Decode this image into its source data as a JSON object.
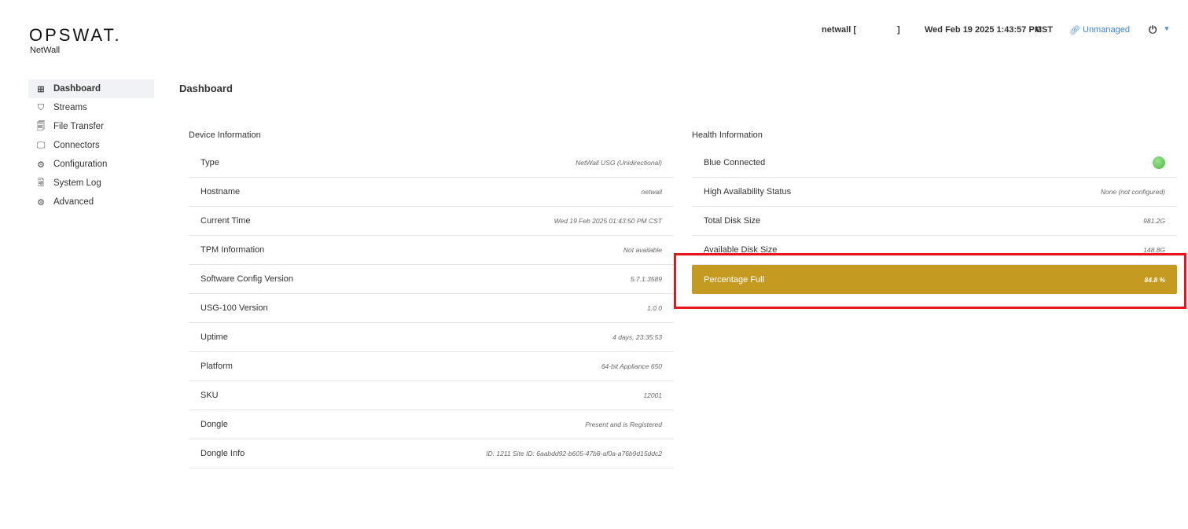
{
  "brand": {
    "logo": "OPSWAT.",
    "product": "NetWall"
  },
  "header": {
    "host": "netwall [",
    "host_end": "]",
    "datetime": "Wed Feb 19 2025 1:43:57 PM",
    "tz": "CST",
    "managed": "Unmanaged"
  },
  "sidebar": {
    "items": [
      {
        "label": "Dashboard",
        "icon": "grid-icon"
      },
      {
        "label": "Streams",
        "icon": "shield-icon"
      },
      {
        "label": "File Transfer",
        "icon": "file-icon"
      },
      {
        "label": "Connectors",
        "icon": "monitor-icon"
      },
      {
        "label": "Configuration",
        "icon": "gear-icon"
      },
      {
        "label": "System Log",
        "icon": "log-icon"
      },
      {
        "label": "Advanced",
        "icon": "gear-icon"
      }
    ]
  },
  "page_title": "Dashboard",
  "device": {
    "title": "Device Information",
    "rows": [
      {
        "k": "Type",
        "v": "NetWall USG (Unidirectional)"
      },
      {
        "k": "Hostname",
        "v": "netwall"
      },
      {
        "k": "Current Time",
        "v": "Wed 19 Feb 2025 01:43:50 PM CST"
      },
      {
        "k": "TPM Information",
        "v": "Not available"
      },
      {
        "k": "Software Config Version",
        "v": "5.7.1.3589"
      },
      {
        "k": "USG-100 Version",
        "v": "1.0.0"
      },
      {
        "k": "Uptime",
        "v": "4 days, 23:35:53"
      },
      {
        "k": "Platform",
        "v": "64-bit Appliance 650"
      },
      {
        "k": "SKU",
        "v": "12001"
      },
      {
        "k": "Dongle",
        "v": "Present and is Registered"
      },
      {
        "k": "Dongle Info",
        "v": "ID: 1211 Site ID: 6aabdd92-b605-47b8-af0a-a76b9d15ddc2"
      }
    ]
  },
  "health": {
    "title": "Health Information",
    "blue_connected": "Blue Connected",
    "rows": [
      {
        "k": "High Availability Status",
        "v": "None (not configured)"
      },
      {
        "k": "Total Disk Size",
        "v": "981.2G"
      },
      {
        "k": "Available Disk Size",
        "v": "148.8G"
      }
    ],
    "percent": {
      "k": "Percentage Full",
      "v": "84.8 %"
    }
  },
  "colors": {
    "warn": "#c59a20",
    "highlight": "#e8151d",
    "link": "#3b82d6"
  }
}
